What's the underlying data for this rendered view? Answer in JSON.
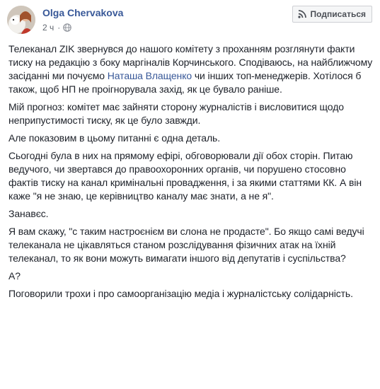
{
  "author": {
    "name": "Olga Chervakova",
    "time": "2 ч",
    "separator": "·",
    "avatar_icon": "avatar-photo",
    "audience_icon": "globe-icon"
  },
  "actions": {
    "subscribe_label": "Подписаться",
    "subscribe_icon": "rss-icon"
  },
  "colors": {
    "name": "#385898",
    "text": "#1d2129",
    "meta": "#616770",
    "button_bg": "#f5f6f7",
    "button_border": "#ced0d4"
  },
  "post": {
    "p1_before": "Телеканал ZIK звернувся до нашого комітету з проханням розглянути факти тиску на редакцію з боку маргіналів Корчинського. Сподіваюсь, на найближчому засіданні ми почуємо ",
    "p1_mention": "Наташа Влащенко",
    "p1_after": " чи інших топ-менеджерів. Хотілося б також, щоб НП не проігнорувала захід, як це бувало раніше.",
    "p2": "Мій прогноз: комітет має зайняти сторону журналістів і висловитися щодо неприпустимості тиску, як це було завжди.",
    "p3": "Але показовим в цьому питанні є одна деталь.",
    "p4": "Сьогодні була в них на прямому ефірі, обговорювали дії обох сторін. Питаю ведучого, чи звертався до правоохоронних органів, чи порушено стосовно фактів тиску на канал кримінальні провадження, і за якими статтями КК. А він каже \"я не знаю, це керівництво каналу має знати, а не я\".",
    "p5": "Занавєс.",
    "p6": "Я вам скажу, \"с таким настроєнієм ви слона не продасте\". Бо якщо самі ведучі телеканала не цікавляться станом розслідування фізичних атак на їхній телеканал, то як вони можуть вимагати іншого від депутатів і суспільства?",
    "p7": "А?",
    "p8": "Поговорили трохи і про самоорганізацію медіа і журналістську солідарність."
  }
}
